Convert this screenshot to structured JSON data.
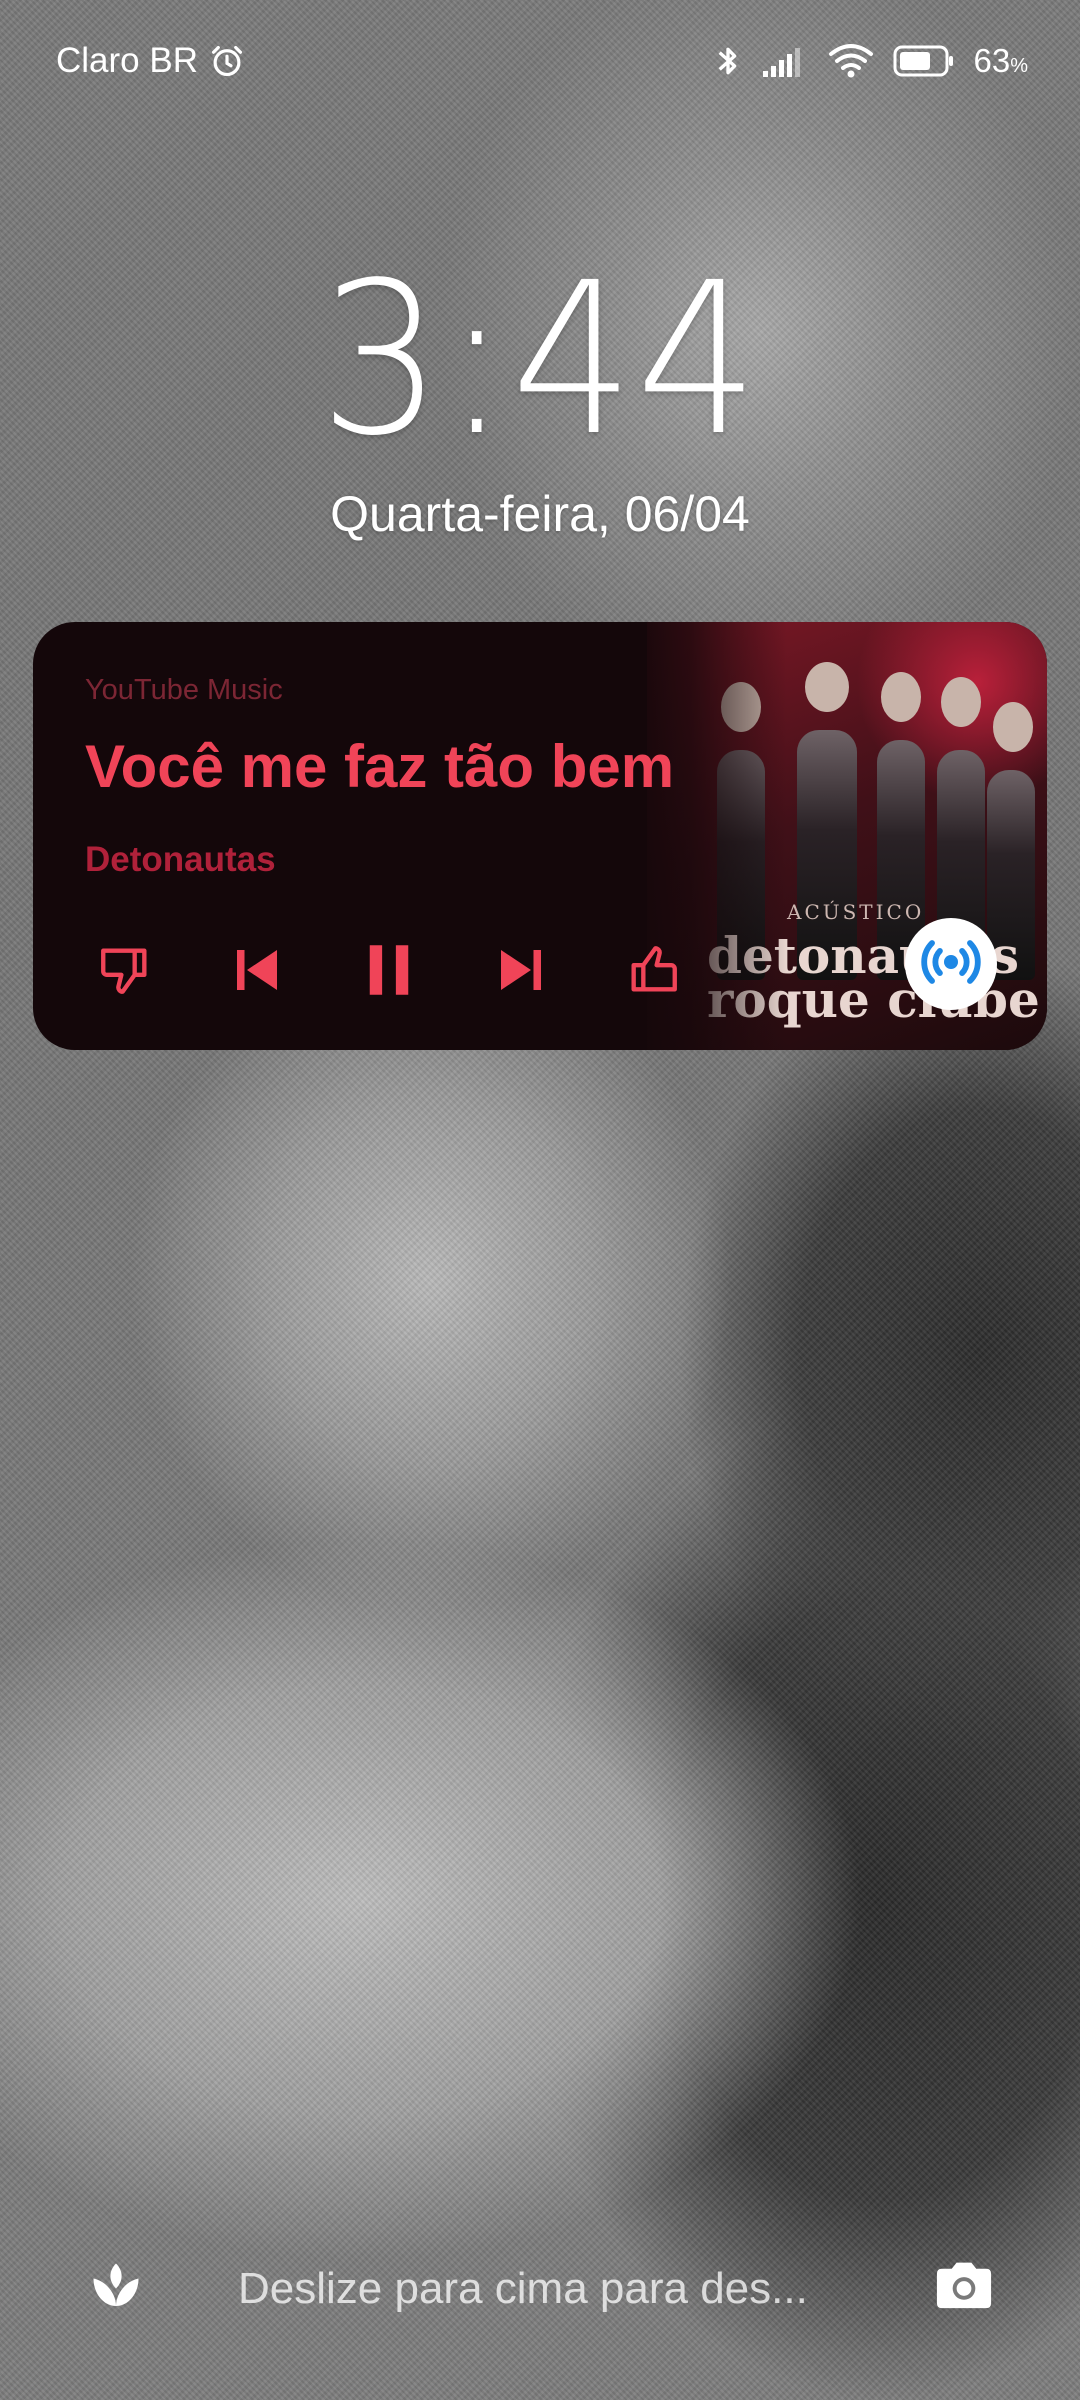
{
  "statusbar": {
    "carrier": "Claro BR",
    "battery_percent": "63",
    "battery_unit": "%"
  },
  "lockscreen": {
    "time": "3:44",
    "date": "Quarta-feira, 06/04"
  },
  "media": {
    "app_name": "YouTube Music",
    "track_title": "Você me faz tão bem",
    "artist": "Detonautas",
    "album_art_text_small": "ACÚSTICO",
    "album_art_text_line1": "detonautas",
    "album_art_text_line2": "roque clube",
    "accent_color": "#f04458",
    "controls": [
      "thumbs-down",
      "previous",
      "pause",
      "next",
      "thumbs-up"
    ]
  },
  "bottom": {
    "hint": "Deslize para cima para des..."
  }
}
